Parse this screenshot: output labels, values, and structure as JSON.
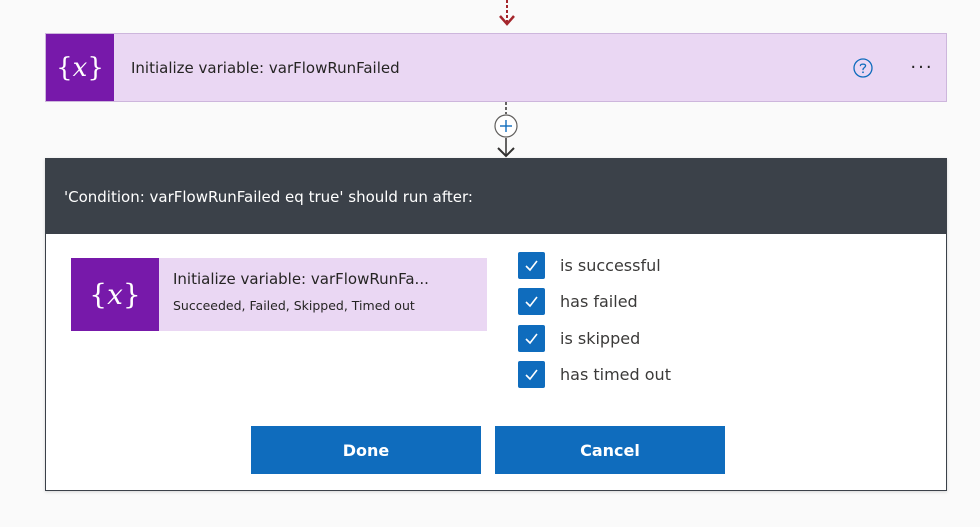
{
  "action": {
    "icon": "variable-icon",
    "title": "Initialize variable: varFlowRunFailed",
    "help_icon": "question-circle-icon",
    "more_icon": "ellipsis-icon",
    "more_text": "···"
  },
  "connector": {
    "add_icon": "plus-circle-icon",
    "arrow_icon": "arrow-down-icon"
  },
  "dialog": {
    "title": "'Condition: varFlowRunFailed eq true' should run after:",
    "run_after_card": {
      "icon": "variable-icon",
      "title": "Initialize variable: varFlowRunFa...",
      "subtitle": "Succeeded, Failed, Skipped, Timed out"
    },
    "options": [
      {
        "label": "is successful",
        "checked": true
      },
      {
        "label": "has failed",
        "checked": true
      },
      {
        "label": "is skipped",
        "checked": true
      },
      {
        "label": "has timed out",
        "checked": true
      }
    ],
    "done_label": "Done",
    "cancel_label": "Cancel"
  },
  "colors": {
    "variable_purple": "#7719aa",
    "card_bg": "#ead7f3",
    "header_bg": "#3b4149",
    "primary_blue": "#0f6cbd",
    "error_arrow": "#a4262c"
  }
}
